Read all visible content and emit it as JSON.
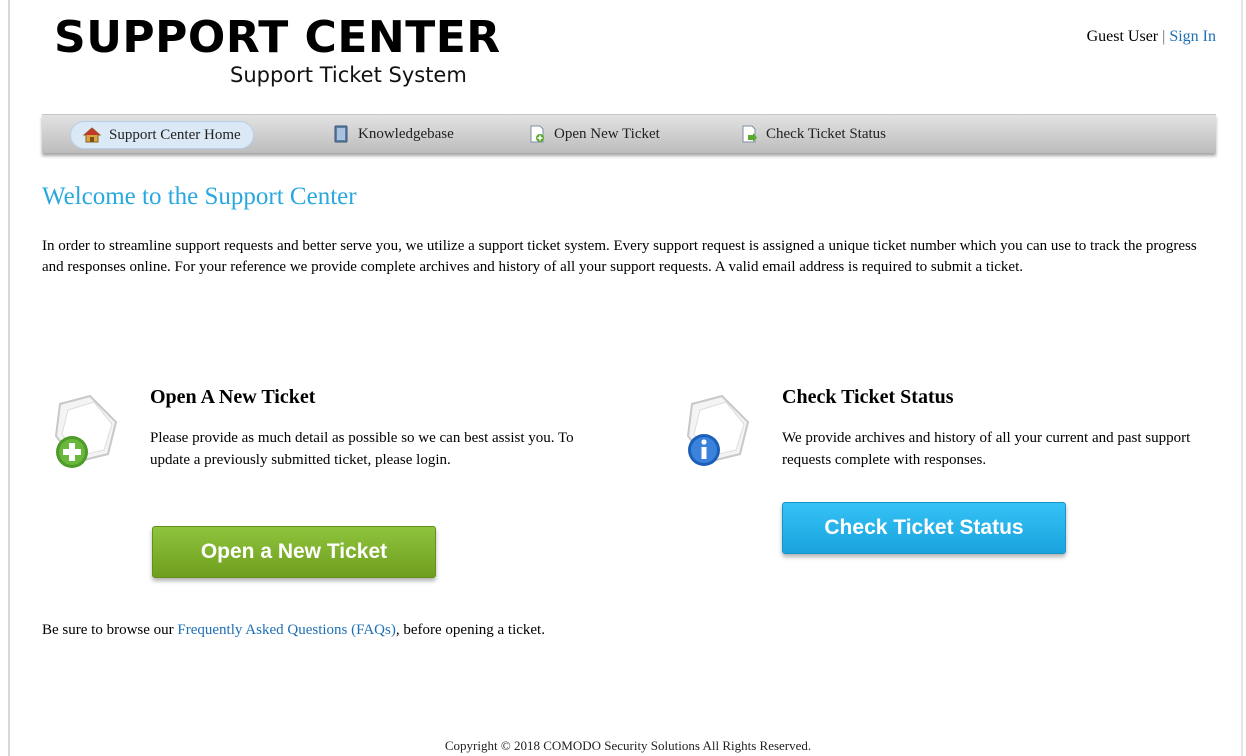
{
  "header": {
    "title": "SUPPORT CENTER",
    "subtitle": "Support Ticket System",
    "user_label": "Guest User",
    "separator": "|",
    "signin_label": "Sign In"
  },
  "nav": {
    "items": [
      {
        "label": "Support Center Home",
        "icon": "home-icon",
        "active": true
      },
      {
        "label": "Knowledgebase",
        "icon": "book-icon",
        "active": false
      },
      {
        "label": "Open New Ticket",
        "icon": "new-ticket-icon",
        "active": false
      },
      {
        "label": "Check Ticket Status",
        "icon": "ticket-status-icon",
        "active": false
      }
    ]
  },
  "main": {
    "welcome_title": "Welcome to the Support Center",
    "intro": "In order to streamline support requests and better serve you, we utilize a support ticket system. Every support request is assigned a unique ticket number which you can use to track the progress and responses online. For your reference we provide complete archives and history of all your support requests. A valid email address is required to submit a ticket."
  },
  "open_ticket": {
    "title": "Open A New Ticket",
    "text": "Please provide as much detail as possible so we can best assist you. To update a previously submitted ticket, please login.",
    "button_label": "Open a New Ticket"
  },
  "check_status": {
    "title": "Check Ticket Status",
    "text": "We provide archives and history of all your current and past support requests complete with responses.",
    "button_label": "Check Ticket Status"
  },
  "faq": {
    "prefix": "Be sure to browse our ",
    "link_label": "Frequently Asked Questions (FAQs)",
    "suffix": ", before opening a ticket."
  },
  "footer": {
    "copyright": "Copyright © 2018 COMODO Security Solutions All Rights Reserved."
  },
  "colors": {
    "accent": "#29a8e0",
    "link": "#1f6fb5",
    "green_button": "#7cb32b",
    "blue_button": "#24b3ea"
  }
}
